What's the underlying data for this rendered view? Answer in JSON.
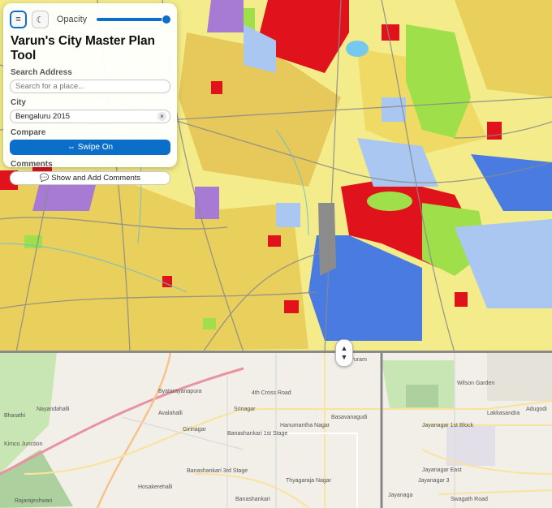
{
  "panel": {
    "menu_icon": "hamburger-menu-icon",
    "theme_icon": "moon-icon",
    "opacity_label": "Opacity",
    "opacity_value": 0.95,
    "title": "Varun's City Master Plan Tool",
    "search": {
      "label": "Search Address",
      "placeholder": "Search for a place..."
    },
    "city": {
      "label": "City",
      "value": "Bengaluru 2015"
    },
    "compare": {
      "label": "Compare",
      "button": "⇔ Swipe On"
    },
    "comments": {
      "label": "Comments",
      "button": "💬 Show and Add Comments"
    }
  },
  "swipe": {
    "up": "▲",
    "down": "▼"
  },
  "colors": {
    "residential": "#f2e46a",
    "mixed": "#e7c85a",
    "commercial": "#e0121c",
    "public": "#6d9ee6",
    "public_semi": "#a9c7f0",
    "industrial": "#a77bd3",
    "park": "#9fe04a",
    "transport": "#8c8c8c",
    "water": "#75c8ee",
    "accent": "#0b6fc9"
  },
  "basemap": {
    "labels": [
      "Byatarayanapura",
      "Avalahalli",
      "Srinagar",
      "Girinagar",
      "Banashankari 1st Stage",
      "Hanumantha Nagar",
      "Basavanagudi",
      "Banashankari 3rd Stage",
      "Thyagaraja Nagar",
      "Banashankari",
      "Hosakerehalli",
      "Rajarajeshwari",
      "Nayandahalli",
      "Jayanagar 1st Block",
      "Jayanagar East",
      "Jayanagar 3",
      "Wilson Garden",
      "Lakkasandra",
      "Adugodi",
      "VV Puram",
      "4th Cross Road",
      "Swagath Road",
      "Jayanaga",
      "Bharathi",
      "Kimco Junction"
    ]
  }
}
